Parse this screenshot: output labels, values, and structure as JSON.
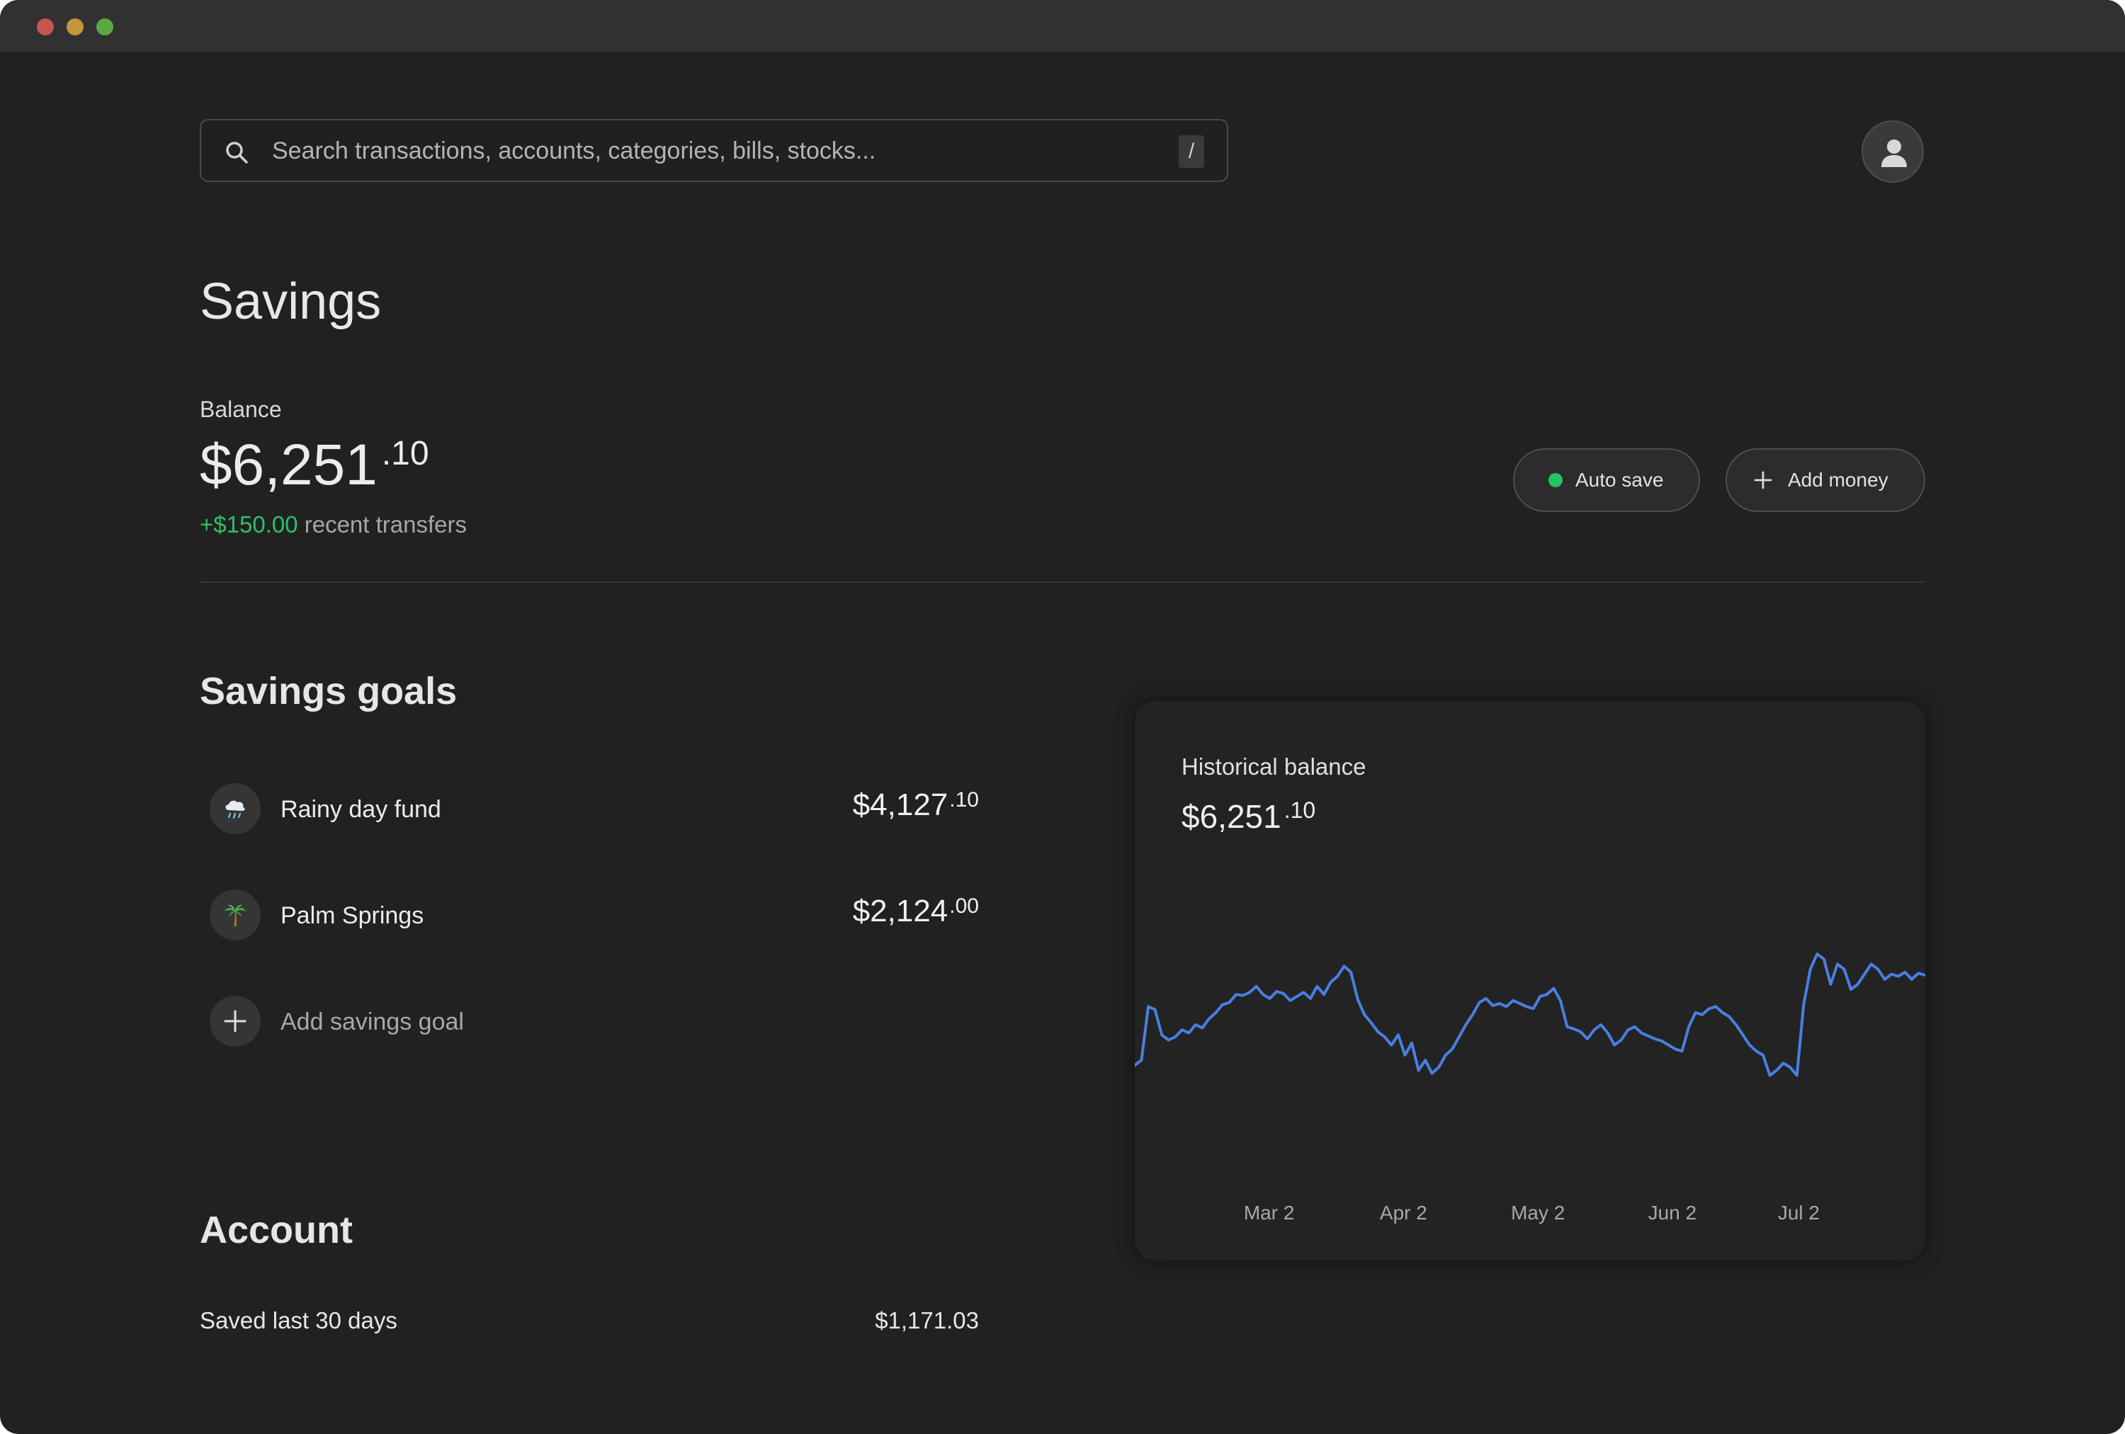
{
  "search": {
    "placeholder": "Search transactions, accounts, categories, bills, stocks...",
    "shortcut": "/"
  },
  "page": {
    "title": "Savings"
  },
  "balance": {
    "label": "Balance",
    "dollars": "$6,251",
    "cents": ".10",
    "change": "+$150.00",
    "change_label": "recent transfers",
    "change_color": "#2fbf6a"
  },
  "actions": {
    "auto_save": "Auto save",
    "auto_save_status_color": "#22c55e",
    "add_money": "Add money"
  },
  "goals": {
    "title": "Savings goals",
    "items": [
      {
        "name": "Rainy day fund",
        "icon": "cloud-rain-icon",
        "dollars": "$4,127",
        "cents": ".10"
      },
      {
        "name": "Palm Springs",
        "icon": "palm-tree-icon",
        "dollars": "$2,124",
        "cents": ".00"
      }
    ],
    "add_label": "Add savings goal"
  },
  "account": {
    "title": "Account",
    "rows": [
      {
        "label": "Saved last 30 days",
        "value": "$1,171.03"
      }
    ]
  },
  "chart": {
    "title": "Historical balance",
    "dollars": "$6,251",
    "cents": ".10"
  },
  "chart_data": {
    "type": "line",
    "line_color": "#4a7fe0",
    "x_tick_labels": [
      "Mar 2",
      "Apr 2",
      "May 2",
      "Jun 2",
      "Jul 2"
    ],
    "x_tick_positions": [
      0.17,
      0.34,
      0.51,
      0.68,
      0.84
    ],
    "x_range": [
      0,
      1
    ],
    "y_range": [
      4500,
      6600
    ],
    "series": [
      {
        "values": [
          5100,
          5150,
          5680,
          5650,
          5400,
          5350,
          5380,
          5450,
          5420,
          5500,
          5470,
          5560,
          5620,
          5700,
          5720,
          5800,
          5790,
          5820,
          5880,
          5800,
          5760,
          5830,
          5810,
          5740,
          5780,
          5820,
          5760,
          5880,
          5800,
          5920,
          5980,
          6080,
          6020,
          5750,
          5600,
          5520,
          5430,
          5380,
          5300,
          5400,
          5200,
          5320,
          5050,
          5150,
          5020,
          5080,
          5200,
          5260,
          5380,
          5500,
          5600,
          5720,
          5760,
          5690,
          5710,
          5680,
          5740,
          5710,
          5680,
          5660,
          5780,
          5800,
          5860,
          5740,
          5480,
          5460,
          5430,
          5360,
          5450,
          5500,
          5420,
          5300,
          5350,
          5450,
          5480,
          5420,
          5390,
          5360,
          5340,
          5300,
          5260,
          5240,
          5480,
          5620,
          5600,
          5660,
          5680,
          5620,
          5580,
          5500,
          5400,
          5300,
          5240,
          5200,
          5000,
          5050,
          5120,
          5080,
          5000,
          5700,
          6050,
          6200,
          6150,
          5900,
          6100,
          6050,
          5850,
          5900,
          6000,
          6100,
          6050,
          5950,
          6000,
          5980,
          6020,
          5950,
          6010,
          5990
        ]
      }
    ]
  }
}
